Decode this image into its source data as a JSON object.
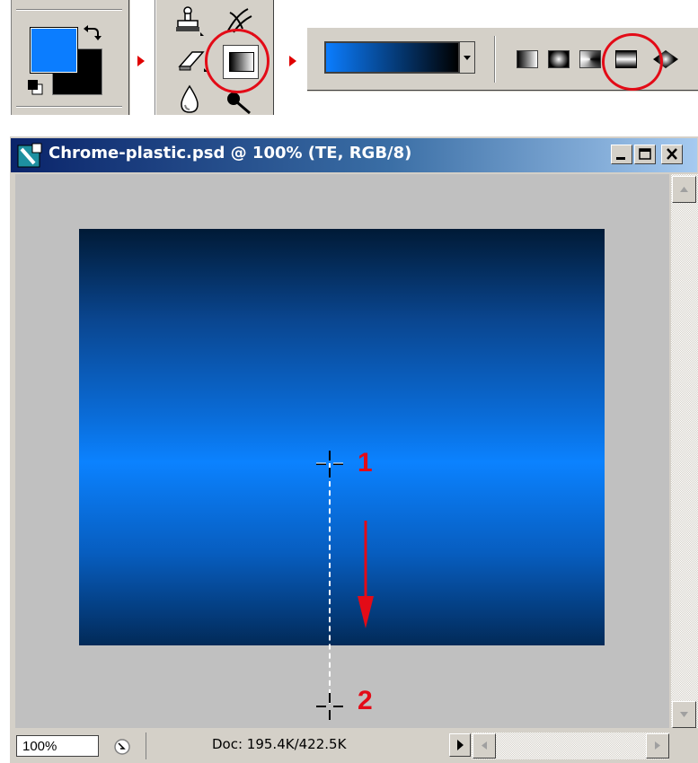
{
  "toolbox": {
    "foreground_color": "#0b7dff",
    "background_color": "#000000",
    "gradient_types": [
      "linear",
      "radial",
      "angle",
      "reflected",
      "diamond"
    ],
    "selected_gradient_type": "reflected",
    "gradient_preview": [
      "#0b7dff",
      "#000000"
    ],
    "highlight_color": "#e30b17"
  },
  "window": {
    "title": "Chrome-plastic.psd @ 100% (TE, RGB/8)",
    "zoom": "100%",
    "doc_info": "Doc: 195.4K/422.5K"
  },
  "canvas": {
    "gradient_stops": [
      "#001a36",
      "#0b82ff",
      "#022a58"
    ],
    "start_label": "1",
    "end_label": "2"
  }
}
